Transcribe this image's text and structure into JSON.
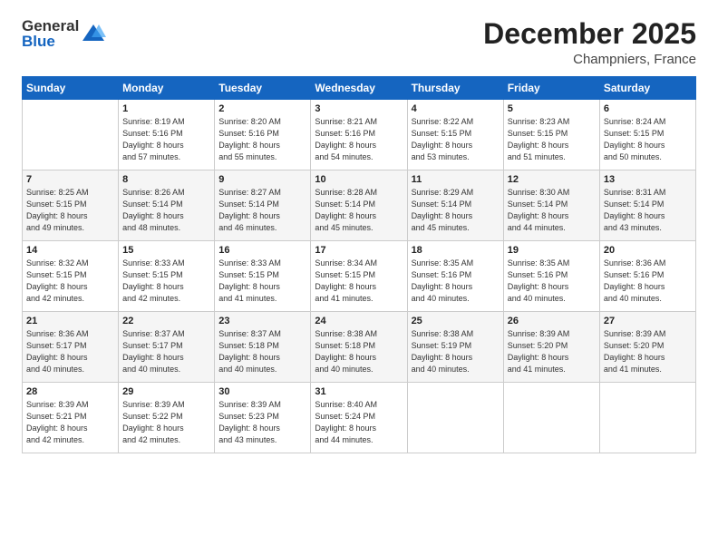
{
  "header": {
    "logo_general": "General",
    "logo_blue": "Blue",
    "month_title": "December 2025",
    "location": "Champniers, France"
  },
  "weekdays": [
    "Sunday",
    "Monday",
    "Tuesday",
    "Wednesday",
    "Thursday",
    "Friday",
    "Saturday"
  ],
  "weeks": [
    [
      {
        "day": "",
        "info": ""
      },
      {
        "day": "1",
        "info": "Sunrise: 8:19 AM\nSunset: 5:16 PM\nDaylight: 8 hours\nand 57 minutes."
      },
      {
        "day": "2",
        "info": "Sunrise: 8:20 AM\nSunset: 5:16 PM\nDaylight: 8 hours\nand 55 minutes."
      },
      {
        "day": "3",
        "info": "Sunrise: 8:21 AM\nSunset: 5:16 PM\nDaylight: 8 hours\nand 54 minutes."
      },
      {
        "day": "4",
        "info": "Sunrise: 8:22 AM\nSunset: 5:15 PM\nDaylight: 8 hours\nand 53 minutes."
      },
      {
        "day": "5",
        "info": "Sunrise: 8:23 AM\nSunset: 5:15 PM\nDaylight: 8 hours\nand 51 minutes."
      },
      {
        "day": "6",
        "info": "Sunrise: 8:24 AM\nSunset: 5:15 PM\nDaylight: 8 hours\nand 50 minutes."
      }
    ],
    [
      {
        "day": "7",
        "info": "Sunrise: 8:25 AM\nSunset: 5:15 PM\nDaylight: 8 hours\nand 49 minutes."
      },
      {
        "day": "8",
        "info": "Sunrise: 8:26 AM\nSunset: 5:14 PM\nDaylight: 8 hours\nand 48 minutes."
      },
      {
        "day": "9",
        "info": "Sunrise: 8:27 AM\nSunset: 5:14 PM\nDaylight: 8 hours\nand 46 minutes."
      },
      {
        "day": "10",
        "info": "Sunrise: 8:28 AM\nSunset: 5:14 PM\nDaylight: 8 hours\nand 45 minutes."
      },
      {
        "day": "11",
        "info": "Sunrise: 8:29 AM\nSunset: 5:14 PM\nDaylight: 8 hours\nand 45 minutes."
      },
      {
        "day": "12",
        "info": "Sunrise: 8:30 AM\nSunset: 5:14 PM\nDaylight: 8 hours\nand 44 minutes."
      },
      {
        "day": "13",
        "info": "Sunrise: 8:31 AM\nSunset: 5:14 PM\nDaylight: 8 hours\nand 43 minutes."
      }
    ],
    [
      {
        "day": "14",
        "info": "Sunrise: 8:32 AM\nSunset: 5:15 PM\nDaylight: 8 hours\nand 42 minutes."
      },
      {
        "day": "15",
        "info": "Sunrise: 8:33 AM\nSunset: 5:15 PM\nDaylight: 8 hours\nand 42 minutes."
      },
      {
        "day": "16",
        "info": "Sunrise: 8:33 AM\nSunset: 5:15 PM\nDaylight: 8 hours\nand 41 minutes."
      },
      {
        "day": "17",
        "info": "Sunrise: 8:34 AM\nSunset: 5:15 PM\nDaylight: 8 hours\nand 41 minutes."
      },
      {
        "day": "18",
        "info": "Sunrise: 8:35 AM\nSunset: 5:16 PM\nDaylight: 8 hours\nand 40 minutes."
      },
      {
        "day": "19",
        "info": "Sunrise: 8:35 AM\nSunset: 5:16 PM\nDaylight: 8 hours\nand 40 minutes."
      },
      {
        "day": "20",
        "info": "Sunrise: 8:36 AM\nSunset: 5:16 PM\nDaylight: 8 hours\nand 40 minutes."
      }
    ],
    [
      {
        "day": "21",
        "info": "Sunrise: 8:36 AM\nSunset: 5:17 PM\nDaylight: 8 hours\nand 40 minutes."
      },
      {
        "day": "22",
        "info": "Sunrise: 8:37 AM\nSunset: 5:17 PM\nDaylight: 8 hours\nand 40 minutes."
      },
      {
        "day": "23",
        "info": "Sunrise: 8:37 AM\nSunset: 5:18 PM\nDaylight: 8 hours\nand 40 minutes."
      },
      {
        "day": "24",
        "info": "Sunrise: 8:38 AM\nSunset: 5:18 PM\nDaylight: 8 hours\nand 40 minutes."
      },
      {
        "day": "25",
        "info": "Sunrise: 8:38 AM\nSunset: 5:19 PM\nDaylight: 8 hours\nand 40 minutes."
      },
      {
        "day": "26",
        "info": "Sunrise: 8:39 AM\nSunset: 5:20 PM\nDaylight: 8 hours\nand 41 minutes."
      },
      {
        "day": "27",
        "info": "Sunrise: 8:39 AM\nSunset: 5:20 PM\nDaylight: 8 hours\nand 41 minutes."
      }
    ],
    [
      {
        "day": "28",
        "info": "Sunrise: 8:39 AM\nSunset: 5:21 PM\nDaylight: 8 hours\nand 42 minutes."
      },
      {
        "day": "29",
        "info": "Sunrise: 8:39 AM\nSunset: 5:22 PM\nDaylight: 8 hours\nand 42 minutes."
      },
      {
        "day": "30",
        "info": "Sunrise: 8:39 AM\nSunset: 5:23 PM\nDaylight: 8 hours\nand 43 minutes."
      },
      {
        "day": "31",
        "info": "Sunrise: 8:40 AM\nSunset: 5:24 PM\nDaylight: 8 hours\nand 44 minutes."
      },
      {
        "day": "",
        "info": ""
      },
      {
        "day": "",
        "info": ""
      },
      {
        "day": "",
        "info": ""
      }
    ]
  ]
}
